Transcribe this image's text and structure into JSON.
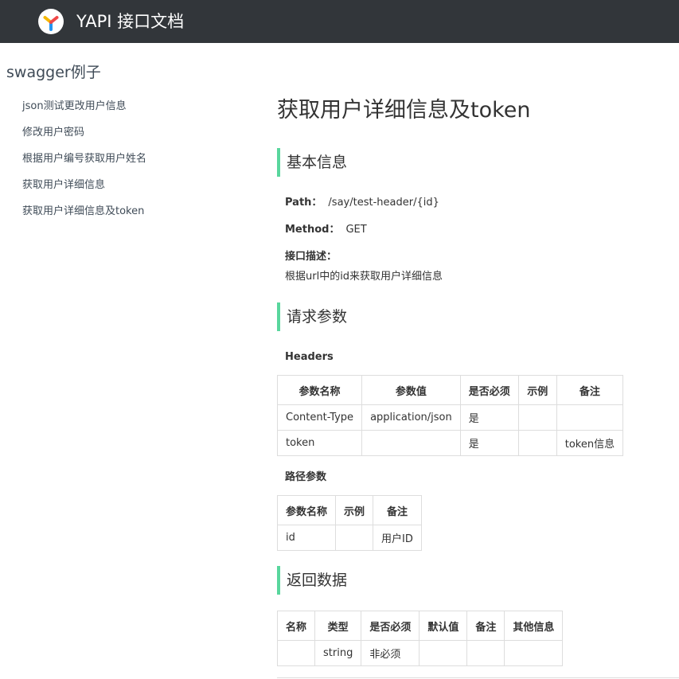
{
  "header": {
    "brand": "YAPI 接口文档"
  },
  "sidebar": {
    "project_title": "swagger例子",
    "items": [
      {
        "label": "json测试更改用户信息"
      },
      {
        "label": "修改用户密码"
      },
      {
        "label": "根据用户编号获取用户姓名"
      },
      {
        "label": "获取用户详细信息"
      },
      {
        "label": "获取用户详细信息及token"
      }
    ]
  },
  "main": {
    "title": "获取用户详细信息及token",
    "basic": {
      "section_title": "基本信息",
      "path_label": "Path：",
      "path_value": "/say/test-header/{id}",
      "method_label": "Method：",
      "method_value": "GET",
      "desc_label": "接口描述：",
      "desc_value": "根据url中的id来获取用户详细信息"
    },
    "request": {
      "section_title": "请求参数",
      "headers_title": "Headers",
      "headers_columns": [
        "参数名称",
        "参数值",
        "是否必须",
        "示例",
        "备注"
      ],
      "headers_rows": [
        [
          "Content-Type",
          "application/json",
          "是",
          "",
          ""
        ],
        [
          "token",
          "",
          "是",
          "",
          "token信息"
        ]
      ],
      "path_params_title": "路径参数",
      "path_params_columns": [
        "参数名称",
        "示例",
        "备注"
      ],
      "path_params_rows": [
        [
          "id",
          "",
          "用户ID"
        ]
      ]
    },
    "response": {
      "section_title": "返回数据",
      "columns": [
        "名称",
        "类型",
        "是否必须",
        "默认值",
        "备注",
        "其他信息"
      ],
      "rows": [
        [
          "",
          "string",
          "非必须",
          "",
          "",
          ""
        ]
      ]
    }
  },
  "colors": {
    "topbar": "#32363a",
    "accent": "#59d69d",
    "logo_yellow": "#f5b800",
    "logo_red": "#f04848",
    "logo_blue": "#2395f1"
  }
}
